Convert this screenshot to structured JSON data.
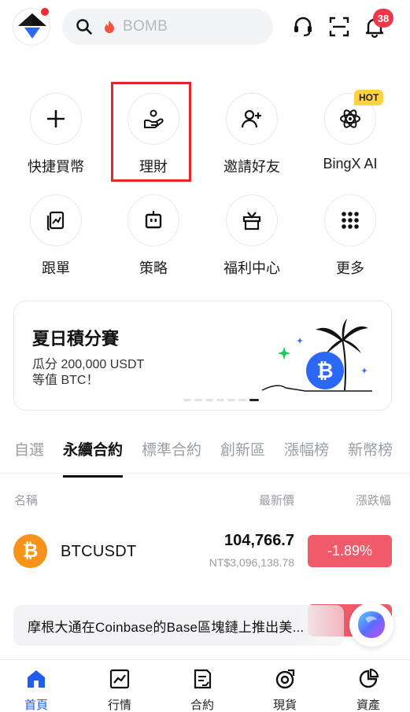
{
  "search": {
    "placeholder": "BOMB"
  },
  "notifications": {
    "count": "38"
  },
  "shortcuts": [
    {
      "label": "快捷買幣",
      "icon": "plus-icon"
    },
    {
      "label": "理財",
      "icon": "hand-coin-icon"
    },
    {
      "label": "邀請好友",
      "icon": "add-user-icon"
    },
    {
      "label": "BingX AI",
      "icon": "atom-icon",
      "tag": "HOT"
    },
    {
      "label": "跟單",
      "icon": "copy-trade-icon"
    },
    {
      "label": "策略",
      "icon": "robot-icon"
    },
    {
      "label": "福利中心",
      "icon": "gift-icon"
    },
    {
      "label": "更多",
      "icon": "grid-dots-icon"
    }
  ],
  "banner": {
    "title": "夏日積分賽",
    "line1": "瓜分 200,000 USDT",
    "line2": "等值 BTC！"
  },
  "market_tabs": [
    "自選",
    "永續合約",
    "標準合約",
    "創新區",
    "漲幅榜",
    "新幣榜"
  ],
  "active_tab": "永續合約",
  "table": {
    "col_name": "名稱",
    "col_price": "最新價",
    "col_change": "漲跌幅",
    "rows": [
      {
        "pair": "BTCUSDT",
        "price": "104,766.7",
        "fiat": "NT$3,096,138.78",
        "change": "-1.89%"
      }
    ]
  },
  "news": {
    "text": "摩根大通在Coinbase的Base區塊鏈上推出美..."
  },
  "bottom_nav": [
    {
      "label": "首頁",
      "icon": "home-icon"
    },
    {
      "label": "行情",
      "icon": "chart-icon"
    },
    {
      "label": "合約",
      "icon": "contract-icon"
    },
    {
      "label": "現貨",
      "icon": "spot-icon"
    },
    {
      "label": "資產",
      "icon": "pie-icon"
    }
  ],
  "colors": {
    "accent": "#1f5cf2",
    "down": "#f05b6a",
    "highlight": "#e7262c",
    "hot": "#ffd23f"
  }
}
